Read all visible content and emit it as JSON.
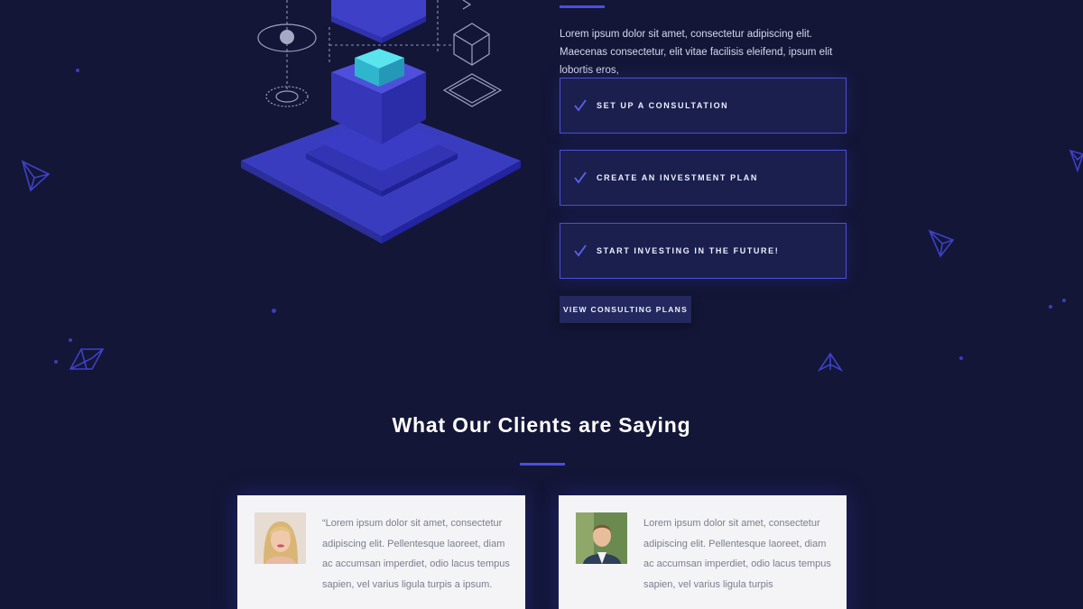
{
  "intro": {
    "text": "Lorem ipsum dolor sit amet, consectetur adipiscing elit. Maecenas consectetur, elit vitae facilisis eleifend, ipsum elit lobortis eros,"
  },
  "steps": [
    {
      "label": "SET UP A CONSULTATION",
      "icon": "check-icon"
    },
    {
      "label": "CREATE AN INVESTMENT PLAN",
      "icon": "check-icon"
    },
    {
      "label": "START INVESTING IN THE FUTURE!",
      "icon": "check-icon"
    }
  ],
  "cta": {
    "label": "VIEW CONSULTING PLANS"
  },
  "testimonials": {
    "title": "What Our Clients are Saying",
    "items": [
      {
        "quote": "“Lorem ipsum dolor sit amet, consectetur adipiscing elit. Pellentesque laoreet, diam ac accumsan imperdiet, odio lacus tempus sapien, vel varius ligula turpis a ipsum.",
        "avatar": "woman-avatar"
      },
      {
        "quote": "Lorem ipsum dolor sit amet, consectetur adipiscing elit. Pellentesque laoreet, diam ac accumsan imperdiet, odio lacus tempus sapien, vel varius ligula turpis",
        "avatar": "man-avatar"
      }
    ]
  },
  "colors": {
    "background": "#131636",
    "accent": "#4a4ee0",
    "card": "#f4f4f6",
    "cube": "#3a3bc4",
    "cube_highlight": "#2fc6d8"
  }
}
